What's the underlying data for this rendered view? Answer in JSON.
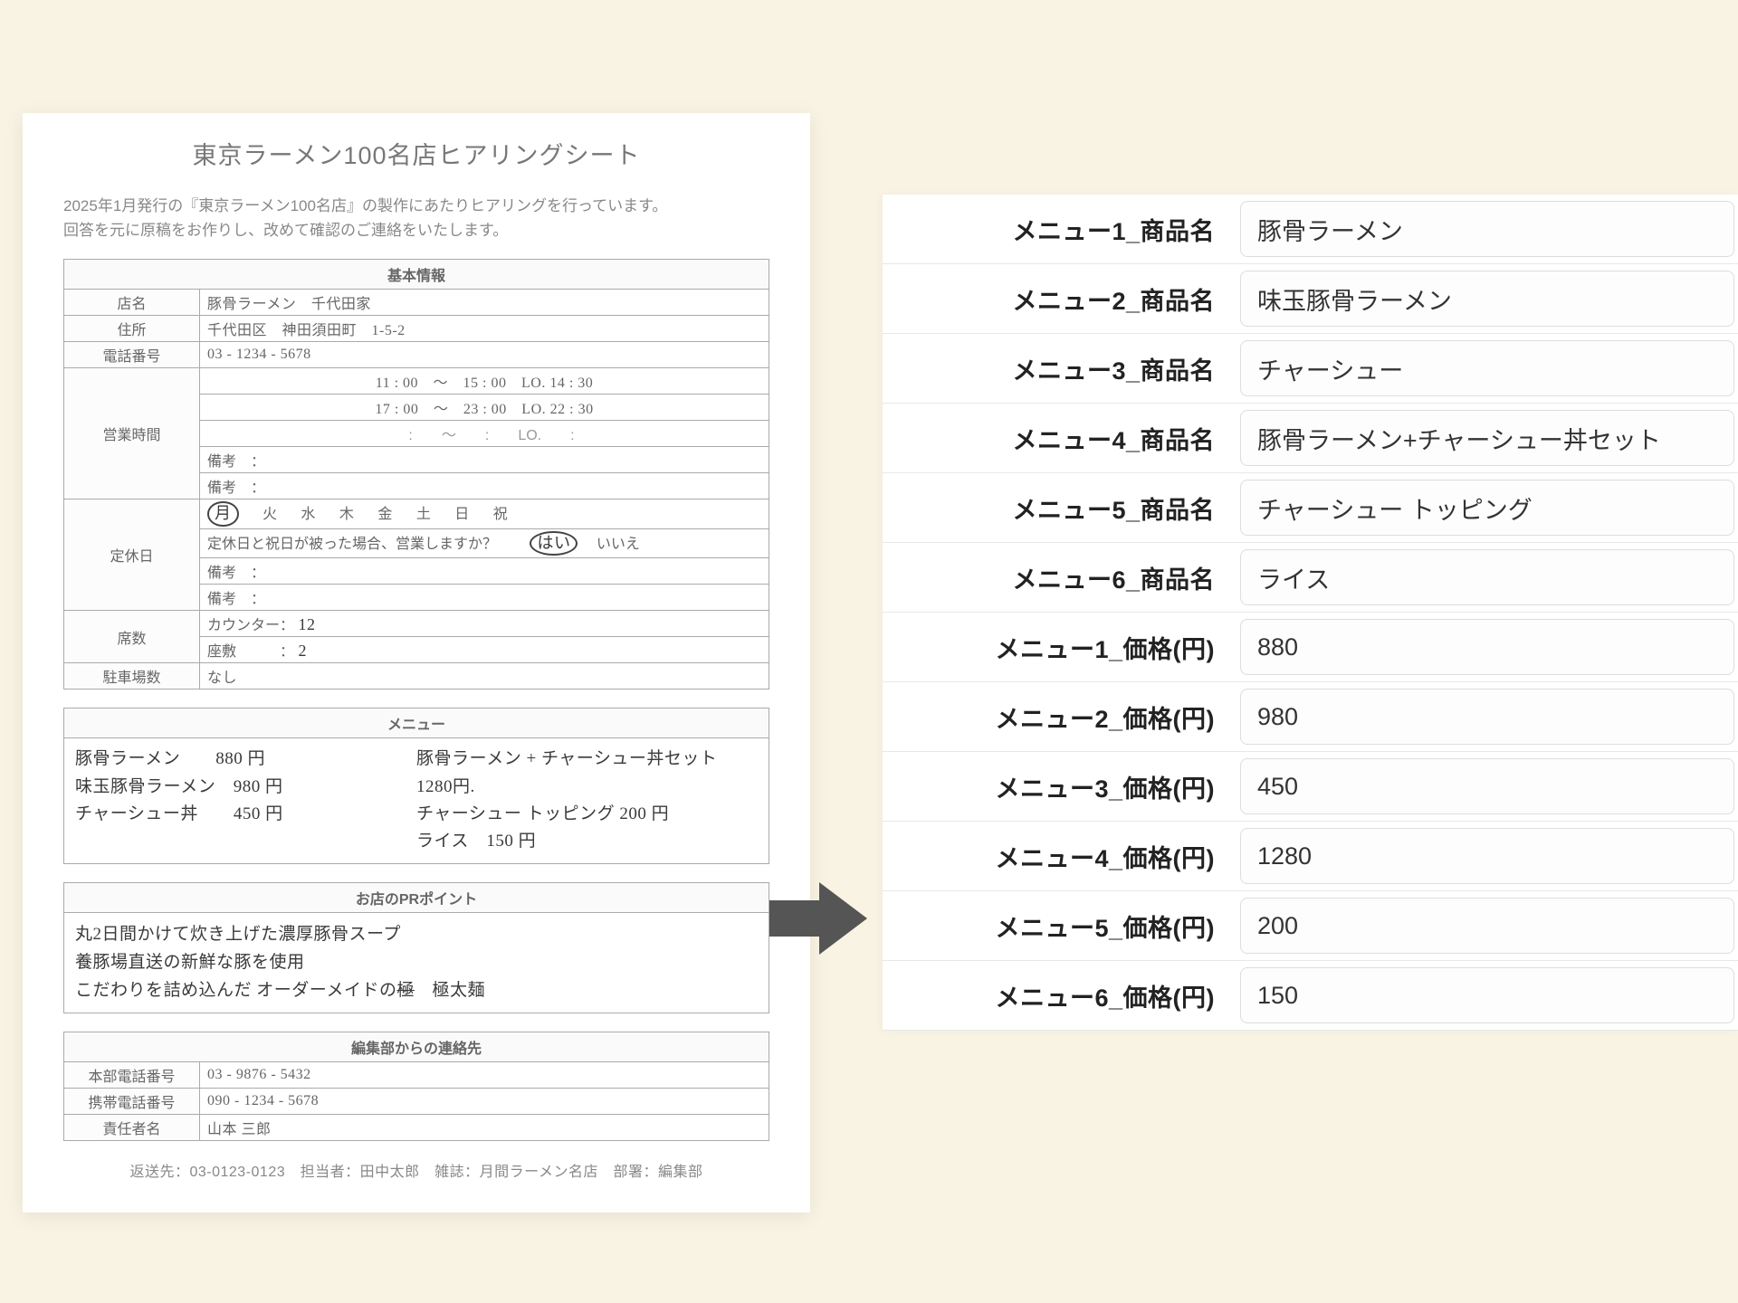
{
  "sheet": {
    "title": "東京ラーメン100名店ヒアリングシート",
    "intro1": "2025年1月発行の『東京ラーメン100名店』の製作にあたりヒアリングを行っています。",
    "intro2": "回答を元に原稿をお作りし、改めて確認のご連絡をいたします。",
    "sections": {
      "basic_header": "基本情報",
      "shop_label": "店名",
      "shop_value": "豚骨ラーメン　千代田家",
      "addr_label": "住所",
      "addr_value": "千代田区　神田須田町　1-5-2",
      "tel_label": "電話番号",
      "tel_value": "03 - 1234 - 5678",
      "hours_label": "営業時間",
      "hours1": "11 : 00　〜　15 : 00　LO. 14 : 30",
      "hours2": "17 : 00　〜　23 : 00　LO. 22 : 30",
      "hours3": "　:　　〜　　:　　LO.　　:　",
      "bikou_label": "備考",
      "holiday_label": "定休日",
      "day_mon": "月",
      "day_tue": "火",
      "day_wed": "水",
      "day_thu": "木",
      "day_fri": "金",
      "day_sat": "土",
      "day_sun": "日",
      "day_hol": "祝",
      "holiday_q": "定休日と祝日が被った場合、営業しますか？",
      "yes": "はい",
      "no": "いいえ",
      "seats_label": "席数",
      "counter_label": "カウンター：",
      "counter_val": "12",
      "zaseki_label": "座敷　　　：",
      "zaseki_val": "2",
      "parking_label": "駐車場数",
      "parking_val": "なし"
    },
    "menu": {
      "header": "メニュー",
      "left1": "豚骨ラーメン　　880 円",
      "left2": "味玉豚骨ラーメン　980 円",
      "left3": "チャーシュー丼　　450 円",
      "right1": "豚骨ラーメン + チャーシュー丼セット 1280円.",
      "right2": "チャーシュー トッピング 200 円",
      "right3": "ライス　150 円"
    },
    "pr": {
      "header": "お店のPRポイント",
      "line1": "丸2日間かけて炊き上げた濃厚豚骨スープ",
      "line2": "養豚場直送の新鮮な豚を使用",
      "line3a": "こだわりを詰め込んだ オーダーメイドの",
      "line3strike": "極",
      "line3b": "　極太麺"
    },
    "contact": {
      "header": "編集部からの連絡先",
      "hq_tel_label": "本部電話番号",
      "hq_tel": "03 - 9876 - 5432",
      "mobile_label": "携帯電話番号",
      "mobile": "090 - 1234 - 5678",
      "person_label": "責任者名",
      "person": "山本 三郎"
    },
    "footer": "返送先：03-0123-0123　担当者：田中太郎　雑誌：月間ラーメン名店　部署：編集部"
  },
  "extracted": {
    "rows": [
      {
        "label": "メニュー1_商品名",
        "value": "豚骨ラーメン"
      },
      {
        "label": "メニュー2_商品名",
        "value": "味玉豚骨ラーメン"
      },
      {
        "label": "メニュー3_商品名",
        "value": "チャーシュー"
      },
      {
        "label": "メニュー4_商品名",
        "value": "豚骨ラーメン+チャーシュー丼セット"
      },
      {
        "label": "メニュー5_商品名",
        "value": "チャーシュー トッピング"
      },
      {
        "label": "メニュー6_商品名",
        "value": "ライス"
      },
      {
        "label": "メニュー1_価格(円)",
        "value": "880"
      },
      {
        "label": "メニュー2_価格(円)",
        "value": "980"
      },
      {
        "label": "メニュー3_価格(円)",
        "value": "450"
      },
      {
        "label": "メニュー4_価格(円)",
        "value": "1280"
      },
      {
        "label": "メニュー5_価格(円)",
        "value": "200"
      },
      {
        "label": "メニュー6_価格(円)",
        "value": "150"
      }
    ]
  }
}
